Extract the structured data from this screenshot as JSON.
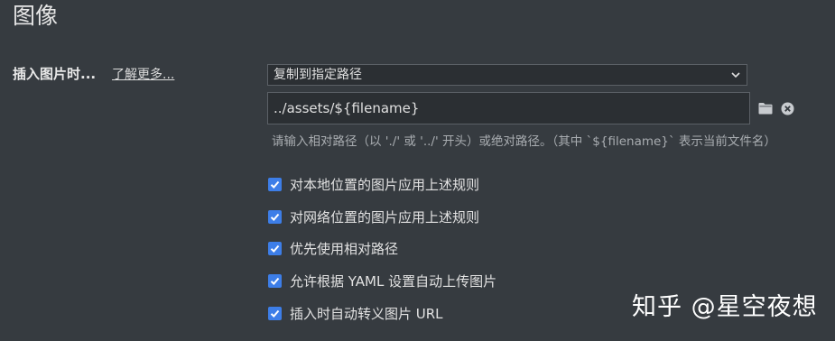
{
  "section": {
    "title": "图像"
  },
  "insert_image": {
    "label": "插入图片时...",
    "learn_more": "了解更多...",
    "select_value": "复制到指定路径",
    "path_value": "../assets/${filename}",
    "hint": "请输入相对路径（以 './' 或 '../' 开头）或绝对路径。（其中 `${filename}` 表示当前文件名）"
  },
  "icons": {
    "dropdown": "chevron-down-icon",
    "browse": "folder-icon",
    "clear": "close-circle-icon",
    "check": "check-icon"
  },
  "checkboxes": [
    {
      "label": "对本地位置的图片应用上述规则",
      "checked": true
    },
    {
      "label": "对网络位置的图片应用上述规则",
      "checked": true
    },
    {
      "label": "优先使用相对路径",
      "checked": true
    },
    {
      "label": "允许根据 YAML 设置自动上传图片",
      "checked": true
    },
    {
      "label": "插入时自动转义图片 URL",
      "checked": true
    }
  ],
  "watermark": "知乎 @星空夜想",
  "colors": {
    "background": "#363b40",
    "checkbox_accent": "#3d7ee8"
  }
}
